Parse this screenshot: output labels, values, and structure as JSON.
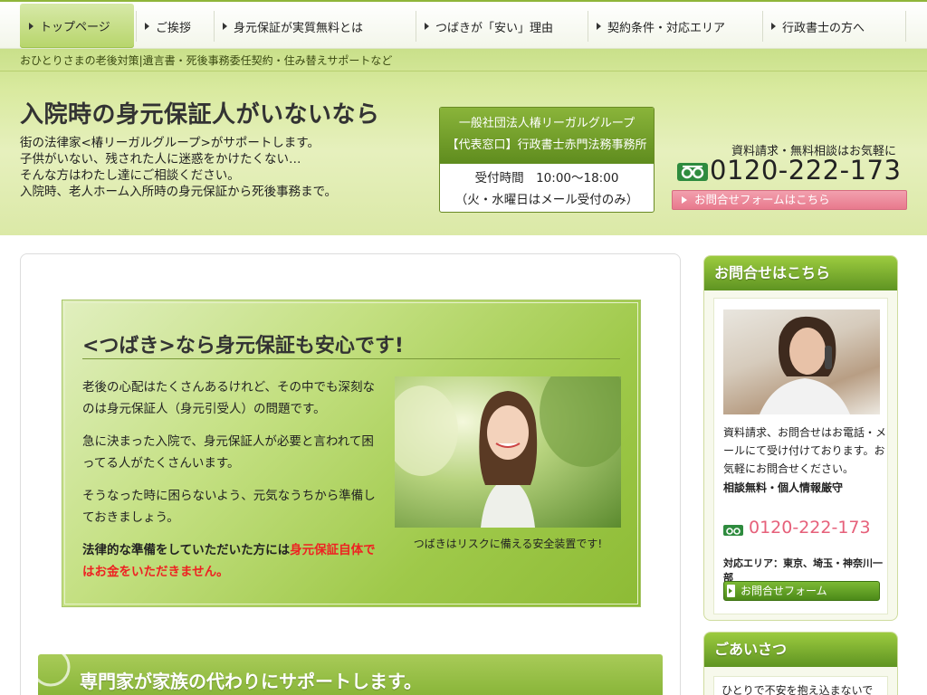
{
  "nav": {
    "items": [
      {
        "label": "トップページ"
      },
      {
        "label": "ご挨拶"
      },
      {
        "label": "身元保証が実質無料とは"
      },
      {
        "label": "つばきが「安い」理由"
      },
      {
        "label": "契約条件・対応エリア"
      },
      {
        "label": "行政書士の方へ"
      }
    ]
  },
  "header": {
    "tagline": "おひとりさまの老後対策|遺言書・死後事務委任契約・住み替えサポートなど",
    "title": "入院時の身元保証人がいないなら",
    "intro": [
      "街の法律家<椿リーガルグループ>がサポートします。",
      "子供がいない、残された人に迷惑をかけたくない…",
      "そんな方はわたし達にご相談ください。",
      "入院時、老人ホーム入所時の身元保証から死後事務まで。"
    ],
    "office": {
      "name": "一般社団法人椿リーガルグループ",
      "rep": "【代表窓口】行政書士赤門法務事務所",
      "hours": "受付時間　10:00〜18:00",
      "note": "（火・水曜日はメール受付のみ）"
    },
    "contact": {
      "lead": "資料請求・無料相談はお気軽に",
      "phone": "0120-222-173",
      "form_button": "お問合せフォームはこちら"
    }
  },
  "feature": {
    "title": "<つばき>なら身元保証も安心です!",
    "paragraphs": [
      "老後の心配はたくさんあるけれど、その中でも深刻なのは身元保証人（身元引受人）の問題です。",
      "急に決まった入院で、身元保証人が必要と言われて困ってる人がたくさんいます。",
      "そうなった時に困らないよう、元気なうちから準備しておきましょう。"
    ],
    "emphasis_pre": "法律的な準備をしていただいた方には",
    "emphasis_red": "身元保証自体ではお金をいただきません。",
    "caption": "つばきはリスクに備える安全装置です!"
  },
  "band": {
    "title": "専門家が家族の代わりにサポートします。"
  },
  "sidebar": {
    "contact": {
      "heading": "お問合せはこちら",
      "text": "資料請求、お問合せはお電話・メールにて受け付けております。お気軽にお問合せください。",
      "bold": "相談無料・個人情報厳守",
      "phone": "0120-222-173",
      "area": "対応エリア：東京、埼玉・神奈川一部",
      "form_button": "お問合せフォーム"
    },
    "greeting": {
      "heading": "ごあいさつ",
      "text": "ひとりで不安を抱え込まないで"
    }
  },
  "colors": {
    "brand_green": "#5f9422",
    "accent_pink": "#e8798d",
    "emphasis_red": "#ee2222"
  }
}
